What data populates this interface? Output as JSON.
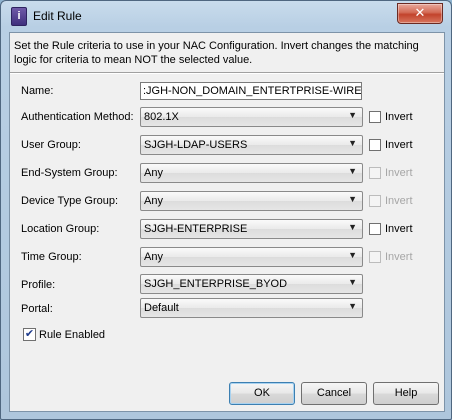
{
  "window": {
    "title": "Edit Rule",
    "close_label": "✕",
    "icon_label": "i"
  },
  "description": "Set the Rule criteria to use in your NAC Configuration. Invert changes the matching logic for criteria to mean NOT the selected value.",
  "fields": {
    "name": {
      "label": "Name:",
      "value": ":JGH-NON_DOMAIN_ENTERTPRISE-WIRELESS"
    },
    "auth_method": {
      "label": "Authentication Method:",
      "value": "802.1X",
      "invert_label": "Invert",
      "invert_checked": false,
      "invert_enabled": true
    },
    "user_group": {
      "label": "User Group:",
      "value": "SJGH-LDAP-USERS",
      "invert_label": "Invert",
      "invert_checked": false,
      "invert_enabled": true
    },
    "end_system_group": {
      "label": "End-System Group:",
      "value": "Any",
      "invert_label": "Invert",
      "invert_checked": false,
      "invert_enabled": false
    },
    "device_type_group": {
      "label": "Device Type Group:",
      "value": "Any",
      "invert_label": "Invert",
      "invert_checked": false,
      "invert_enabled": false
    },
    "location_group": {
      "label": "Location Group:",
      "value": "SJGH-ENTERPRISE",
      "invert_label": "Invert",
      "invert_checked": false,
      "invert_enabled": true
    },
    "time_group": {
      "label": "Time Group:",
      "value": "Any",
      "invert_label": "Invert",
      "invert_checked": false,
      "invert_enabled": false
    },
    "profile": {
      "label": "Profile:",
      "value": "SJGH_ENTERPRISE_BYOD"
    },
    "portal": {
      "label": "Portal:",
      "value": "Default"
    }
  },
  "rule_enabled": {
    "label": "Rule Enabled",
    "checked": true,
    "check_glyph": "✔"
  },
  "buttons": {
    "ok": "OK",
    "cancel": "Cancel",
    "help": "Help"
  },
  "icons": {
    "dropdown_arrow": "▼"
  }
}
